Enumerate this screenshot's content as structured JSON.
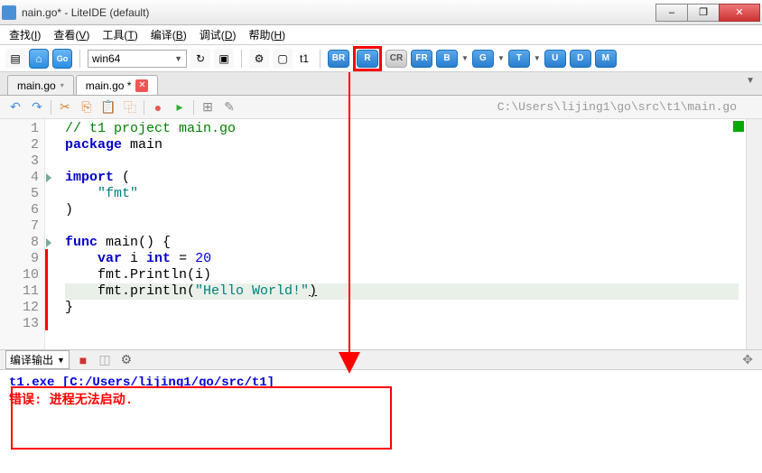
{
  "window": {
    "title": "nain.go* - LiteIDE (default)"
  },
  "win_btns": {
    "min": "–",
    "max": "❐",
    "close": "✕"
  },
  "menu": {
    "find": "查找",
    "find_k": "I",
    "view": "查看",
    "view_k": "V",
    "tools": "工具",
    "tools_k": "T",
    "build": "编译",
    "build_k": "B",
    "debug": "调试",
    "debug_k": "D",
    "help": "帮助",
    "help_k": "H"
  },
  "toolbar": {
    "env_combo": "win64",
    "t1_label": "t1",
    "btns": {
      "br": "BR",
      "r": "R",
      "cr": "CR",
      "fr": "FR",
      "b": "B",
      "g": "G",
      "t": "T",
      "u": "U",
      "d": "D",
      "m": "M"
    }
  },
  "tabs": {
    "t0": "main.go",
    "t1": "main.go *"
  },
  "file_path": "C:\\Users\\lijing1\\go\\src\\t1\\main.go",
  "code": {
    "l1": "// t1 project main.go",
    "l2a": "package",
    "l2b": " main",
    "l4a": "import",
    "l4b": " (",
    "l5": "    \"fmt\"",
    "l6": ")",
    "l8a": "func",
    "l8b": " main() {",
    "l9a": "    ",
    "l9b": "var",
    "l9c": " i ",
    "l9d": "int",
    "l9e": " = ",
    "l9f": "20",
    "l10": "    fmt.Println(i)",
    "l11a": "    fmt.println(",
    "l11b": "\"Hello World!\"",
    "l11c": ")",
    "l12": "}"
  },
  "lines": {
    "n1": "1",
    "n2": "2",
    "n3": "3",
    "n4": "4",
    "n5": "5",
    "n6": "6",
    "n7": "7",
    "n8": "8",
    "n9": "9",
    "n10": "10",
    "n11": "11",
    "n12": "12",
    "n13": "13"
  },
  "output": {
    "header": "编译输出",
    "line1": "t1.exe  [C:/Users/lijing1/go/src/t1]",
    "line2": "错误: 进程无法启动."
  },
  "icons": {
    "home": "⌂",
    "go": "Go",
    "gear": "⚙",
    "folder": "▢",
    "check": "☑",
    "undo": "↶",
    "redo": "↷",
    "cut": "✂",
    "copy": "⎘",
    "paste": "📋",
    "dup": "⿻",
    "rec": "●",
    "pause": "▸",
    "grid": "⊞",
    "wand": "✎",
    "stop": "■",
    "eraser": "◫"
  }
}
